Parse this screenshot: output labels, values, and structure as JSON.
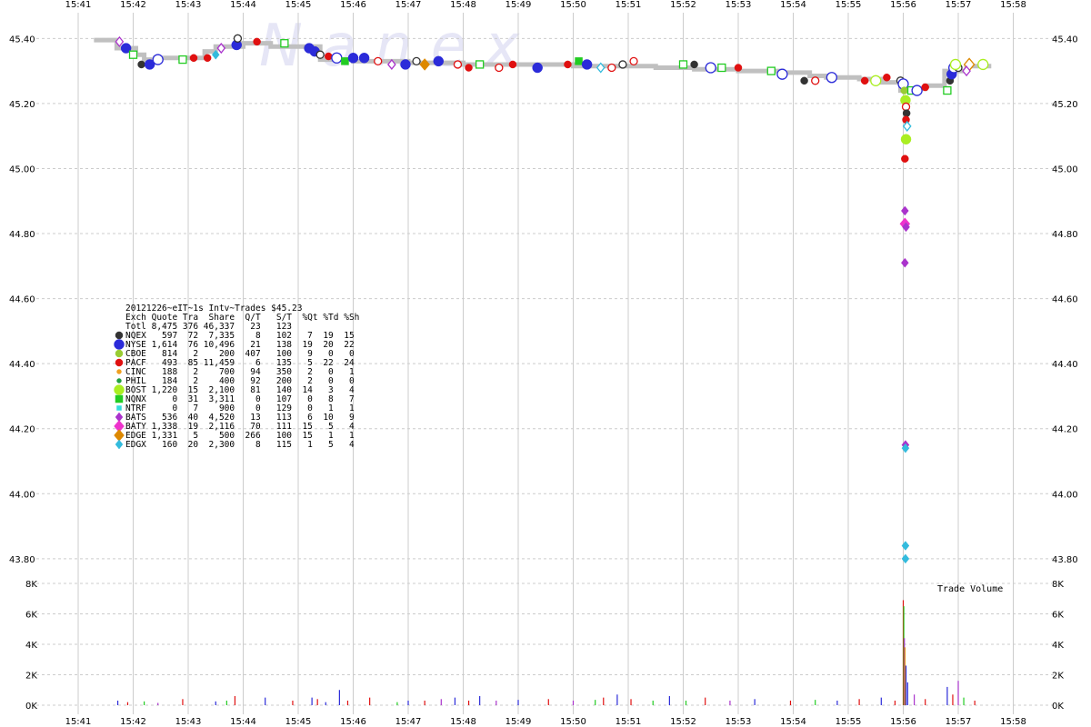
{
  "watermark": "N a n e x",
  "chart_data": {
    "type": "scatter",
    "title": "20121226~eIT~1s Intv~Trades $45.23",
    "time_ticks": [
      "15:41",
      "15:42",
      "15:43",
      "15:44",
      "15:45",
      "15:46",
      "15:47",
      "15:48",
      "15:49",
      "15:50",
      "15:51",
      "15:52",
      "15:53",
      "15:54",
      "15:55",
      "15:56",
      "15:57",
      "15:58"
    ],
    "price_ticks": [
      "45.40",
      "45.20",
      "45.00",
      "44.80",
      "44.60",
      "44.40",
      "44.20",
      "44.00",
      "43.80"
    ],
    "price_range": [
      43.78,
      45.44
    ],
    "volume_ticks": [
      "8K",
      "6K",
      "4K",
      "2K",
      "0K"
    ],
    "volume_range": [
      0,
      8000
    ],
    "volume_label": "Trade Volume",
    "legend": {
      "header": "Exch Quote Tra  Share  Q/T   S/T  %Qt %Td %Sh",
      "total": "Totl 8,475 376 46,337   23   123",
      "rows": [
        {
          "exch": "NQEX",
          "text": "NQEX   597  72  7,335    8   102   7  19  15",
          "color": "#333333",
          "marker": "circle"
        },
        {
          "exch": "NYSE",
          "text": "NYSE 1,614  76 10,496   21   138  19  20  22",
          "color": "#2b2bd9",
          "marker": "bigcircle"
        },
        {
          "exch": "CBOE",
          "text": "CBOE   814   2    200  407   100   9   0   0",
          "color": "#99cc33",
          "marker": "circle"
        },
        {
          "exch": "PACF",
          "text": "PACF   493  85 11,459    6   135   5  22  24",
          "color": "#e01010",
          "marker": "circle"
        },
        {
          "exch": "CINC",
          "text": "CINC   188   2    700   94   350   2   0   1",
          "color": "#f0a020",
          "marker": "smallcircle"
        },
        {
          "exch": "PHIL",
          "text": "PHIL   184   2    400   92   200   2   0   0",
          "color": "#20a040",
          "marker": "smallcircle"
        },
        {
          "exch": "BOST",
          "text": "BOST 1,220  15  2,100   81   140  14   3   4",
          "color": "#aaee22",
          "marker": "bigcircle"
        },
        {
          "exch": "NQNX",
          "text": "NQNX     0  31  3,311    0   107   0   8   7",
          "color": "#22cc22",
          "marker": "square"
        },
        {
          "exch": "NTRF",
          "text": "NTRF     0   7    900    0   129   0   1   1",
          "color": "#33dddd",
          "marker": "smallsquare"
        },
        {
          "exch": "BATS",
          "text": "BATS   536  40  4,520   13   113   6  10   9",
          "color": "#aa33cc",
          "marker": "diamond"
        },
        {
          "exch": "BATY",
          "text": "BATY 1,338  19  2,116   70   111  15   5   4",
          "color": "#ee33cc",
          "marker": "bigdiamond"
        },
        {
          "exch": "EDGE",
          "text": "EDGE 1,331   5    500  266   100  15   1   1",
          "color": "#dd8800",
          "marker": "bigdiamond"
        },
        {
          "exch": "EDGX",
          "text": "EDGX   160  20  2,300    8   115   1   5   4",
          "color": "#33bbdd",
          "marker": "diamond"
        }
      ]
    },
    "nbbo_steps": [
      {
        "t": 0.7,
        "p": 45.395
      },
      {
        "t": 1.05,
        "p": 45.37
      },
      {
        "t": 1.2,
        "p": 45.35
      },
      {
        "t": 1.4,
        "p": 45.335
      },
      {
        "t": 1.7,
        "p": 45.34
      },
      {
        "t": 2.3,
        "p": 45.34
      },
      {
        "t": 2.5,
        "p": 45.36
      },
      {
        "t": 3.0,
        "p": 45.375
      },
      {
        "t": 3.5,
        "p": 45.385
      },
      {
        "t": 4.4,
        "p": 45.375
      },
      {
        "t": 5.0,
        "p": 45.335
      },
      {
        "t": 6.0,
        "p": 45.33
      },
      {
        "t": 7.0,
        "p": 45.325
      },
      {
        "t": 8.0,
        "p": 45.32
      },
      {
        "t": 9.0,
        "p": 45.32
      },
      {
        "t": 9.8,
        "p": 45.315
      },
      {
        "t": 10.5,
        "p": 45.315
      },
      {
        "t": 11.2,
        "p": 45.31
      },
      {
        "t": 12.0,
        "p": 45.305
      },
      {
        "t": 12.8,
        "p": 45.3
      },
      {
        "t": 13.3,
        "p": 45.295
      },
      {
        "t": 13.6,
        "p": 45.285
      },
      {
        "t": 14.2,
        "p": 45.28
      },
      {
        "t": 14.6,
        "p": 45.275
      },
      {
        "t": 14.95,
        "p": 45.265
      },
      {
        "t": 15.2,
        "p": 45.24
      },
      {
        "t": 15.4,
        "p": 45.245
      },
      {
        "t": 15.75,
        "p": 45.255
      },
      {
        "t": 16.15,
        "p": 45.3
      },
      {
        "t": 16.6,
        "p": 45.315
      }
    ],
    "trades": [
      {
        "t": 0.75,
        "p": 45.39,
        "ex": "BATS",
        "open": true
      },
      {
        "t": 0.87,
        "p": 45.37,
        "ex": "NYSE",
        "open": false
      },
      {
        "t": 1.0,
        "p": 45.35,
        "ex": "NQNX",
        "open": true
      },
      {
        "t": 1.15,
        "p": 45.32,
        "ex": "NQEX",
        "open": false
      },
      {
        "t": 1.3,
        "p": 45.32,
        "ex": "NYSE",
        "open": false
      },
      {
        "t": 1.45,
        "p": 45.335,
        "ex": "NYSE",
        "open": true
      },
      {
        "t": 1.9,
        "p": 45.335,
        "ex": "NQNX",
        "open": true
      },
      {
        "t": 2.1,
        "p": 45.34,
        "ex": "PACF",
        "open": false
      },
      {
        "t": 2.35,
        "p": 45.34,
        "ex": "PACF",
        "open": false
      },
      {
        "t": 2.5,
        "p": 45.35,
        "ex": "EDGX",
        "open": false
      },
      {
        "t": 2.6,
        "p": 45.37,
        "ex": "BATS",
        "open": true
      },
      {
        "t": 2.88,
        "p": 45.38,
        "ex": "NYSE",
        "open": false
      },
      {
        "t": 2.9,
        "p": 45.4,
        "ex": "NQEX",
        "open": true
      },
      {
        "t": 3.25,
        "p": 45.39,
        "ex": "PACF",
        "open": false
      },
      {
        "t": 3.75,
        "p": 45.385,
        "ex": "NQNX",
        "open": true
      },
      {
        "t": 4.2,
        "p": 45.37,
        "ex": "NYSE",
        "open": false
      },
      {
        "t": 4.3,
        "p": 45.36,
        "ex": "NYSE",
        "open": false
      },
      {
        "t": 4.4,
        "p": 45.35,
        "ex": "NQEX",
        "open": true
      },
      {
        "t": 4.55,
        "p": 45.345,
        "ex": "PACF",
        "open": false
      },
      {
        "t": 4.7,
        "p": 45.34,
        "ex": "NYSE",
        "open": true
      },
      {
        "t": 4.85,
        "p": 45.33,
        "ex": "NQNX",
        "open": false
      },
      {
        "t": 5.0,
        "p": 45.34,
        "ex": "NYSE",
        "open": false
      },
      {
        "t": 5.2,
        "p": 45.34,
        "ex": "NYSE",
        "open": false
      },
      {
        "t": 5.45,
        "p": 45.33,
        "ex": "PACF",
        "open": true
      },
      {
        "t": 5.7,
        "p": 45.32,
        "ex": "BATS",
        "open": true
      },
      {
        "t": 5.95,
        "p": 45.32,
        "ex": "NYSE",
        "open": false
      },
      {
        "t": 6.15,
        "p": 45.33,
        "ex": "NQEX",
        "open": true
      },
      {
        "t": 6.3,
        "p": 45.32,
        "ex": "EDGE",
        "open": false
      },
      {
        "t": 6.55,
        "p": 45.33,
        "ex": "NYSE",
        "open": false
      },
      {
        "t": 6.9,
        "p": 45.32,
        "ex": "PACF",
        "open": true
      },
      {
        "t": 7.1,
        "p": 45.31,
        "ex": "PACF",
        "open": false
      },
      {
        "t": 7.3,
        "p": 45.32,
        "ex": "NQNX",
        "open": true
      },
      {
        "t": 7.65,
        "p": 45.31,
        "ex": "PACF",
        "open": true
      },
      {
        "t": 7.9,
        "p": 45.32,
        "ex": "PACF",
        "open": false
      },
      {
        "t": 8.35,
        "p": 45.31,
        "ex": "NYSE",
        "open": false
      },
      {
        "t": 8.9,
        "p": 45.32,
        "ex": "PACF",
        "open": false
      },
      {
        "t": 9.1,
        "p": 45.33,
        "ex": "NQNX",
        "open": false
      },
      {
        "t": 9.25,
        "p": 45.32,
        "ex": "NYSE",
        "open": false
      },
      {
        "t": 9.5,
        "p": 45.31,
        "ex": "EDGX",
        "open": true
      },
      {
        "t": 9.7,
        "p": 45.31,
        "ex": "PACF",
        "open": true
      },
      {
        "t": 9.9,
        "p": 45.32,
        "ex": "NQEX",
        "open": true
      },
      {
        "t": 10.1,
        "p": 45.33,
        "ex": "PACF",
        "open": true
      },
      {
        "t": 11.0,
        "p": 45.32,
        "ex": "NQNX",
        "open": true
      },
      {
        "t": 11.2,
        "p": 45.32,
        "ex": "NQEX",
        "open": false
      },
      {
        "t": 11.5,
        "p": 45.31,
        "ex": "NYSE",
        "open": true
      },
      {
        "t": 11.7,
        "p": 45.31,
        "ex": "NQNX",
        "open": true
      },
      {
        "t": 12.0,
        "p": 45.31,
        "ex": "PACF",
        "open": false
      },
      {
        "t": 12.6,
        "p": 45.3,
        "ex": "NQNX",
        "open": true
      },
      {
        "t": 12.8,
        "p": 45.29,
        "ex": "NYSE",
        "open": true
      },
      {
        "t": 13.2,
        "p": 45.27,
        "ex": "NQEX",
        "open": false
      },
      {
        "t": 13.4,
        "p": 45.27,
        "ex": "PACF",
        "open": true
      },
      {
        "t": 13.7,
        "p": 45.28,
        "ex": "NYSE",
        "open": true
      },
      {
        "t": 14.3,
        "p": 45.27,
        "ex": "PACF",
        "open": false
      },
      {
        "t": 14.5,
        "p": 45.27,
        "ex": "BOST",
        "open": true
      },
      {
        "t": 14.7,
        "p": 45.28,
        "ex": "PACF",
        "open": false
      },
      {
        "t": 14.95,
        "p": 45.27,
        "ex": "NQEX",
        "open": true
      },
      {
        "t": 15.0,
        "p": 45.26,
        "ex": "NYSE",
        "open": true
      },
      {
        "t": 15.02,
        "p": 45.24,
        "ex": "CBOE",
        "open": false
      },
      {
        "t": 15.04,
        "p": 45.21,
        "ex": "BOST",
        "open": false
      },
      {
        "t": 15.05,
        "p": 45.19,
        "ex": "PACF",
        "open": true
      },
      {
        "t": 15.06,
        "p": 45.17,
        "ex": "NQEX",
        "open": false
      },
      {
        "t": 15.05,
        "p": 45.15,
        "ex": "PACF",
        "open": false
      },
      {
        "t": 15.07,
        "p": 45.13,
        "ex": "EDGX",
        "open": true
      },
      {
        "t": 15.05,
        "p": 45.09,
        "ex": "BOST",
        "open": false
      },
      {
        "t": 15.03,
        "p": 45.03,
        "ex": "PACF",
        "open": false
      },
      {
        "t": 15.03,
        "p": 44.87,
        "ex": "BATS",
        "open": false
      },
      {
        "t": 15.03,
        "p": 44.83,
        "ex": "BATY",
        "open": false
      },
      {
        "t": 15.05,
        "p": 44.82,
        "ex": "BATS",
        "open": false
      },
      {
        "t": 15.03,
        "p": 44.71,
        "ex": "BATS",
        "open": false
      },
      {
        "t": 15.04,
        "p": 44.15,
        "ex": "BATS",
        "open": false
      },
      {
        "t": 15.04,
        "p": 44.14,
        "ex": "EDGX",
        "open": false
      },
      {
        "t": 15.04,
        "p": 43.84,
        "ex": "EDGX",
        "open": false
      },
      {
        "t": 15.04,
        "p": 43.8,
        "ex": "EDGX",
        "open": false
      },
      {
        "t": 15.15,
        "p": 45.24,
        "ex": "NQNX",
        "open": true
      },
      {
        "t": 15.25,
        "p": 45.24,
        "ex": "NYSE",
        "open": true
      },
      {
        "t": 15.4,
        "p": 45.25,
        "ex": "PACF",
        "open": false
      },
      {
        "t": 15.8,
        "p": 45.24,
        "ex": "NQNX",
        "open": true
      },
      {
        "t": 15.85,
        "p": 45.27,
        "ex": "NQEX",
        "open": false
      },
      {
        "t": 15.88,
        "p": 45.29,
        "ex": "NYSE",
        "open": false
      },
      {
        "t": 15.92,
        "p": 45.31,
        "ex": "NYSE",
        "open": true
      },
      {
        "t": 16.0,
        "p": 45.31,
        "ex": "NQEX",
        "open": true
      },
      {
        "t": 15.95,
        "p": 45.32,
        "ex": "BOST",
        "open": true
      },
      {
        "t": 16.2,
        "p": 45.32,
        "ex": "EDGE",
        "open": true
      },
      {
        "t": 16.15,
        "p": 45.3,
        "ex": "BATS",
        "open": true
      },
      {
        "t": 16.45,
        "p": 45.32,
        "ex": "BOST",
        "open": true
      }
    ],
    "volumes": [
      {
        "t": 0.72,
        "v": 300,
        "c": "#2b2bd9"
      },
      {
        "t": 0.9,
        "v": 200,
        "c": "#e01010"
      },
      {
        "t": 1.2,
        "v": 250,
        "c": "#22cc22"
      },
      {
        "t": 1.45,
        "v": 150,
        "c": "#aa33cc"
      },
      {
        "t": 1.9,
        "v": 400,
        "c": "#e01010"
      },
      {
        "t": 2.5,
        "v": 250,
        "c": "#2b2bd9"
      },
      {
        "t": 2.7,
        "v": 300,
        "c": "#22cc22"
      },
      {
        "t": 2.85,
        "v": 600,
        "c": "#e01010"
      },
      {
        "t": 3.4,
        "v": 500,
        "c": "#2b2bd9"
      },
      {
        "t": 3.9,
        "v": 300,
        "c": "#e01010"
      },
      {
        "t": 4.25,
        "v": 500,
        "c": "#2b2bd9"
      },
      {
        "t": 4.35,
        "v": 400,
        "c": "#e01010"
      },
      {
        "t": 4.5,
        "v": 200,
        "c": "#2b2bd9"
      },
      {
        "t": 4.75,
        "v": 1000,
        "c": "#2b2bd9"
      },
      {
        "t": 4.9,
        "v": 300,
        "c": "#e01010"
      },
      {
        "t": 5.3,
        "v": 500,
        "c": "#e01010"
      },
      {
        "t": 5.8,
        "v": 200,
        "c": "#22cc22"
      },
      {
        "t": 6.0,
        "v": 300,
        "c": "#2b2bd9"
      },
      {
        "t": 6.3,
        "v": 300,
        "c": "#e01010"
      },
      {
        "t": 6.6,
        "v": 400,
        "c": "#aa33cc"
      },
      {
        "t": 6.85,
        "v": 500,
        "c": "#2b2bd9"
      },
      {
        "t": 7.1,
        "v": 300,
        "c": "#e01010"
      },
      {
        "t": 7.3,
        "v": 600,
        "c": "#2b2bd9"
      },
      {
        "t": 7.6,
        "v": 300,
        "c": "#aa33cc"
      },
      {
        "t": 8.0,
        "v": 350,
        "c": "#2b2bd9"
      },
      {
        "t": 8.55,
        "v": 400,
        "c": "#e01010"
      },
      {
        "t": 9.0,
        "v": 300,
        "c": "#aa33cc"
      },
      {
        "t": 9.4,
        "v": 350,
        "c": "#22cc22"
      },
      {
        "t": 9.55,
        "v": 500,
        "c": "#e01010"
      },
      {
        "t": 9.8,
        "v": 700,
        "c": "#2b2bd9"
      },
      {
        "t": 10.05,
        "v": 400,
        "c": "#e01010"
      },
      {
        "t": 10.45,
        "v": 300,
        "c": "#22cc22"
      },
      {
        "t": 10.75,
        "v": 600,
        "c": "#2b2bd9"
      },
      {
        "t": 11.05,
        "v": 300,
        "c": "#22cc22"
      },
      {
        "t": 11.4,
        "v": 500,
        "c": "#e01010"
      },
      {
        "t": 11.85,
        "v": 300,
        "c": "#aa33cc"
      },
      {
        "t": 12.3,
        "v": 400,
        "c": "#2b2bd9"
      },
      {
        "t": 12.95,
        "v": 300,
        "c": "#e01010"
      },
      {
        "t": 13.4,
        "v": 350,
        "c": "#22cc22"
      },
      {
        "t": 13.8,
        "v": 300,
        "c": "#2b2bd9"
      },
      {
        "t": 14.2,
        "v": 400,
        "c": "#e01010"
      },
      {
        "t": 14.6,
        "v": 500,
        "c": "#2b2bd9"
      },
      {
        "t": 14.85,
        "v": 300,
        "c": "#e01010"
      },
      {
        "t": 15.0,
        "v": 6900,
        "c": "#e01010"
      },
      {
        "t": 15.01,
        "v": 6500,
        "c": "#22cc22"
      },
      {
        "t": 15.02,
        "v": 4400,
        "c": "#aa33cc"
      },
      {
        "t": 15.03,
        "v": 3800,
        "c": "#dd8800"
      },
      {
        "t": 15.05,
        "v": 2600,
        "c": "#2b2bd9"
      },
      {
        "t": 15.08,
        "v": 1500,
        "c": "#2b2bd9"
      },
      {
        "t": 15.2,
        "v": 700,
        "c": "#aa33cc"
      },
      {
        "t": 15.4,
        "v": 400,
        "c": "#e01010"
      },
      {
        "t": 15.8,
        "v": 1200,
        "c": "#2b2bd9"
      },
      {
        "t": 15.9,
        "v": 700,
        "c": "#e01010"
      },
      {
        "t": 16.0,
        "v": 1600,
        "c": "#aa33cc"
      },
      {
        "t": 16.1,
        "v": 500,
        "c": "#22cc22"
      },
      {
        "t": 16.3,
        "v": 300,
        "c": "#e01010"
      }
    ],
    "grid": true,
    "colors": {
      "grid": "#cccccc",
      "nbbo": "#c0c0c0",
      "axis": "#666666"
    }
  }
}
